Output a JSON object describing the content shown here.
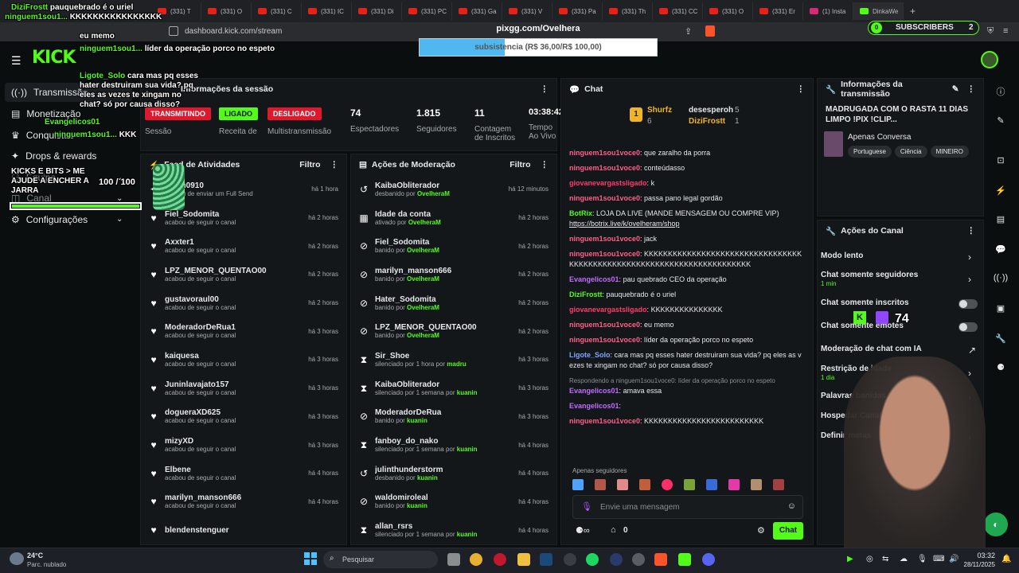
{
  "browser": {
    "tabs": [
      {
        "label": "(331) T"
      },
      {
        "label": "(331) O"
      },
      {
        "label": "(331) C"
      },
      {
        "label": "(331) IC"
      },
      {
        "label": "(331) Di"
      },
      {
        "label": "(331) PC"
      },
      {
        "label": "(331) Ga"
      },
      {
        "label": "(331) V"
      },
      {
        "label": "(331) Pa"
      },
      {
        "label": "(331) Th"
      },
      {
        "label": "(331) CC"
      },
      {
        "label": "(331) O"
      },
      {
        "label": "(331) Er"
      },
      {
        "label": "(1) Insta"
      },
      {
        "label": "DinkaWe"
      }
    ],
    "url": "dashboard.kick.com/stream"
  },
  "stream_overlay": {
    "pix_url": "pixgg.com/Ovelhera",
    "subsistencia": "subsistencia (R$ 36,00/R$ 100,00)",
    "subsistencia_progress": 0.36,
    "subscribers_label": "SUBSCRIBERS",
    "subscribers_count": "2",
    "subscribers_new": "0",
    "kicks_label": "KICKS E BITS > ME AJUDE A ENCHER A JARRA",
    "kicks_value": "100 / 100",
    "follower_count_overlay": "74",
    "overlay_chat": [
      {
        "user": "DiziFrostt",
        "text": "pauquebrado é o uriel"
      },
      {
        "user": "ninguem1sou1...",
        "text": "KKKKKKKKKKKKKKKK"
      },
      {
        "user": "",
        "text": "eu memo"
      },
      {
        "user": "ninguem1sou1...",
        "text": "líder da operação porco no espeto"
      },
      {
        "user": "Ligote_Solo",
        "text": "cara mas pq esses hater destruiram sua vida? pq eles as vezes te xingam no chat? só por causa disso?"
      },
      {
        "user": "Evangelicos01",
        "text": ""
      },
      {
        "user": "ninguem1sou1...",
        "text": "KKK"
      }
    ]
  },
  "sidebar": {
    "items": [
      {
        "label": "Transmissão",
        "icon": "broadcast-icon"
      },
      {
        "label": "Monetização",
        "icon": "money-icon"
      },
      {
        "label": "Conquistas",
        "icon": "trophy-icon"
      },
      {
        "label": "Drops & rewards",
        "icon": "gift-icon"
      },
      {
        "label": "Equipe",
        "icon": "team-icon"
      },
      {
        "label": "Canal",
        "icon": "channel-icon"
      },
      {
        "label": "Configurações",
        "icon": "gear-icon"
      }
    ]
  },
  "session": {
    "title": "Informações da sessão",
    "badges": [
      {
        "label": "TRANSMITINDO",
        "color": "#e0182d"
      },
      {
        "label": "LIGADO",
        "color": "#53fc18"
      },
      {
        "label": "DESLIGADO",
        "color": "#e0182d"
      }
    ],
    "badge_captions": [
      "Sessão",
      "Receita de",
      "Multistransmissão"
    ],
    "stats": [
      {
        "value": "74",
        "label": "Espectadores"
      },
      {
        "value": "1.815",
        "label": "Seguidores"
      },
      {
        "value": "11",
        "label": "Contagem de Inscritos"
      },
      {
        "value": "03:38:42",
        "label": "Tempo Ao Vivo"
      }
    ]
  },
  "activity_feed": {
    "title": "Feed de Atividades",
    "filter_label": "Filtro",
    "items": [
      {
        "name": "...oon0910",
        "sub": "acabou de enviar um Full Send",
        "time": "há 1 hora",
        "icon": "gift-icon"
      },
      {
        "name": "Fiel_Sodomita",
        "sub": "acabou de seguir o canal",
        "time": "há 2 horas",
        "icon": "heart-icon"
      },
      {
        "name": "Axxter1",
        "sub": "acabou de seguir o canal",
        "time": "há 2 horas",
        "icon": "heart-icon"
      },
      {
        "name": "LPZ_MENOR_QUENTAO00",
        "sub": "acabou de seguir o canal",
        "time": "há 2 horas",
        "icon": "heart-icon"
      },
      {
        "name": "gustavoraul00",
        "sub": "acabou de seguir o canal",
        "time": "há 2 horas",
        "icon": "heart-icon"
      },
      {
        "name": "ModeradorDeRua1",
        "sub": "acabou de seguir o canal",
        "time": "há 3 horas",
        "icon": "heart-icon"
      },
      {
        "name": "kaiquesa",
        "sub": "acabou de seguir o canal",
        "time": "há 3 horas",
        "icon": "heart-icon"
      },
      {
        "name": "Juninlavajato157",
        "sub": "acabou de seguir o canal",
        "time": "há 3 horas",
        "icon": "heart-icon"
      },
      {
        "name": "dogueraXD625",
        "sub": "acabou de seguir o canal",
        "time": "há 3 horas",
        "icon": "heart-icon"
      },
      {
        "name": "mizyXD",
        "sub": "acabou de seguir o canal",
        "time": "há 3 horas",
        "icon": "heart-icon"
      },
      {
        "name": "Elbene",
        "sub": "acabou de seguir o canal",
        "time": "há 4 horas",
        "icon": "heart-icon"
      },
      {
        "name": "marilyn_manson666",
        "sub": "acabou de seguir o canal",
        "time": "há 4 horas",
        "icon": "heart-icon"
      },
      {
        "name": "blendenstenguer",
        "sub": "",
        "time": "",
        "icon": "heart-icon"
      }
    ]
  },
  "mod_actions": {
    "title": "Ações de Moderação",
    "filter_label": "Filtro",
    "items": [
      {
        "name": "KaibaObliterador",
        "action": "desbanido por",
        "by": "OvelheraM",
        "time": "há 12 minutos",
        "icon": "undo-icon"
      },
      {
        "name": "Idade da conta",
        "action": "ativado por",
        "by": "OvelheraM",
        "time": "há 2 horas",
        "icon": "calendar-icon"
      },
      {
        "name": "Fiel_Sodomita",
        "action": "banido por",
        "by": "OvelheraM",
        "time": "há 2 horas",
        "icon": "ban-icon"
      },
      {
        "name": "marilyn_manson666",
        "action": "banido por",
        "by": "OvelheraM",
        "time": "há 2 horas",
        "icon": "ban-icon"
      },
      {
        "name": "Hater_Sodomita",
        "action": "banido por",
        "by": "OvelheraM",
        "time": "há 2 horas",
        "icon": "ban-icon"
      },
      {
        "name": "LPZ_MENOR_QUENTAO00",
        "action": "banido por",
        "by": "OvelheraM",
        "time": "há 2 horas",
        "icon": "ban-icon"
      },
      {
        "name": "Sir_Shoe",
        "action": "silenciado por 1 hora por",
        "by": "madru",
        "time": "há 3 horas",
        "icon": "hourglass-icon"
      },
      {
        "name": "KaibaObliterador",
        "action": "silenciado por 1 semana por",
        "by": "kuanin",
        "time": "há 3 horas",
        "icon": "hourglass-icon"
      },
      {
        "name": "ModeradorDeRua",
        "action": "banido por",
        "by": "kuanin",
        "time": "há 3 horas",
        "icon": "ban-icon"
      },
      {
        "name": "fanboy_do_nako",
        "action": "silenciado por 1 semana por",
        "by": "kuanin",
        "time": "há 4 horas",
        "icon": "hourglass-icon"
      },
      {
        "name": "julinthunderstorm",
        "action": "desbanido por",
        "by": "kuanin",
        "time": "há 4 horas",
        "icon": "undo-icon"
      },
      {
        "name": "waldomiroleal",
        "action": "banido por",
        "by": "kuanin",
        "time": "há 4 horas",
        "icon": "ban-icon"
      },
      {
        "name": "allan_rsrs",
        "action": "silenciado por 1 semana por",
        "by": "kuanin",
        "time": "há 4 horas",
        "icon": "hourglass-icon"
      }
    ]
  },
  "chat": {
    "title": "Chat",
    "leaderboard": [
      {
        "name": "Shurfz",
        "count": "6",
        "rank": "1"
      },
      {
        "name": "desesperoh",
        "count": "5"
      },
      {
        "name": "DiziFrostt",
        "count": "1"
      }
    ],
    "messages": [
      {
        "user": "ninguem1sou1voce0",
        "color": "#ff5e8a",
        "text": "que zaralho da porra"
      },
      {
        "user": "ninguem1sou1voce0",
        "color": "#ff5e8a",
        "text": "conteúdasso"
      },
      {
        "user": "giovanevargastsligado",
        "color": "#ff3a6e",
        "text": "k"
      },
      {
        "user": "ninguem1sou1voce0",
        "color": "#ff5e8a",
        "text": "passa pano legal gordão"
      },
      {
        "user": "BotRix",
        "color": "#53fc18",
        "text": "LOJA DA LIVE (MANDE MENSAGEM OU COMPRE VIP)",
        "link": "https://botrix.live/k/ovelheram/shop"
      },
      {
        "user": "ninguem1sou1voce0",
        "color": "#ff5e8a",
        "text": "jack"
      },
      {
        "user": "ninguem1sou1voce0",
        "color": "#ff5e8a",
        "text": "KKKKKKKKKKKKKKKKKKKKKKKKKKKKKKKKKKKKKKKKKKKKKKKKKKKKKKKKKKKKKKKKKKKKKKK"
      },
      {
        "user": "Evangelicos01",
        "color": "#c26bff",
        "text": "pau quebrado CEO da operação"
      },
      {
        "user": "DiziFrostt",
        "color": "#53fc18",
        "text": "pauquebrado é o uriel"
      },
      {
        "user": "giovanevargastsligado",
        "color": "#ff3a6e",
        "text": "KKKKKKKKKKKKKKK"
      },
      {
        "user": "ninguem1sou1voce0",
        "color": "#ff5e8a",
        "text": "eu memo"
      },
      {
        "user": "ninguem1sou1voce0",
        "color": "#ff5e8a",
        "text": "líder da operação porco no espeto"
      },
      {
        "user": "Ligote_Solo",
        "color": "#7ea6ff",
        "text": "cara mas pq esses hater destruiram sua vida? pq eles as vezes te xingam no chat? só por causa disso?"
      },
      {
        "user": "Evangelicos01",
        "color": "#c26bff",
        "text": "amava essa",
        "reply": "Respondendo a ninguem1sou1voce0: líder da operação porco no espeto"
      },
      {
        "user": "Evangelicos01",
        "color": "#c26bff",
        "text": ""
      },
      {
        "user": "ninguem1sou1voce0",
        "color": "#ff5e8a",
        "text": "KKKKKKKKKKKKKKKKKKKKKKKKK"
      }
    ],
    "followers_only_label": "Apenas seguidores",
    "input_placeholder": "Envie uma mensagem",
    "points": "0",
    "send_label": "Chat"
  },
  "stream_info": {
    "title": "Informações da transmissão",
    "stream_title": "MADRUGADA COM O RASTA 11 DIAS LIMPO !PIX !CLIP...",
    "category": "Apenas Conversa",
    "tags": [
      "Portuguese",
      "Ciência",
      "MINEIRO"
    ]
  },
  "channel_actions": {
    "title": "Ações do Canal",
    "items": [
      {
        "label": "Modo lento",
        "sub": "",
        "control": "chevron"
      },
      {
        "label": "Chat somente seguidores",
        "sub": "1 min",
        "control": "chevron"
      },
      {
        "label": "Chat somente inscritos",
        "sub": "",
        "control": "toggle"
      },
      {
        "label": "Chat somente emotes",
        "sub": "",
        "control": "toggle"
      },
      {
        "label": "Moderação de chat com IA",
        "sub": "",
        "control": "external"
      },
      {
        "label": "Restrição de idade",
        "sub": "1 dia",
        "control": "chevron"
      },
      {
        "label": "Palavras banidas",
        "sub": "",
        "control": "chevron"
      },
      {
        "label": "Hospedar Canal",
        "sub": "",
        "control": "none"
      },
      {
        "label": "Definir metas",
        "sub": "",
        "control": "chevron"
      }
    ]
  },
  "taskbar": {
    "weather_temp": "24°C",
    "weather_desc": "Parc. nublado",
    "search_placeholder": "Pesquisar",
    "time": "03:32",
    "date": "28/11/2025"
  },
  "colors": {
    "kick_green": "#53fc18",
    "live_red": "#e0182d",
    "panel_bg": "#141719"
  }
}
